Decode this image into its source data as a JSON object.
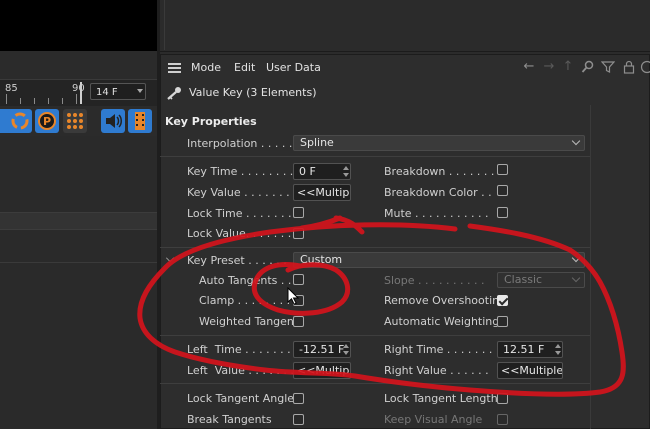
{
  "timeline": {
    "label_85": "85",
    "label_90": "90",
    "frame": "14 F"
  },
  "menubar": {
    "items": [
      "Mode",
      "Edit",
      "User Data"
    ]
  },
  "object_line": {
    "title": "Value Key (3 Elements)"
  },
  "section": {
    "title": "Key Properties"
  },
  "interpolation": {
    "label": "Interpolation . . . . .",
    "value": "Spline"
  },
  "key_time": {
    "label": "Key Time . . . . . . . .",
    "value": "0 F"
  },
  "key_value": {
    "label": "Key Value . . . . . . . .",
    "value": "<<Multiple Values>>"
  },
  "lock_time": {
    "label": "Lock Time . . . . . . . ."
  },
  "lock_value": {
    "label": "Lock Value. . . . . . . ."
  },
  "breakdown": {
    "label": "Breakdown . . . . . . ."
  },
  "breakdown_color": {
    "label": "Breakdown Color . ."
  },
  "mute": {
    "label": "Mute . . . . . . . . . . ."
  },
  "key_preset": {
    "label": "Key Preset . . . . . .",
    "value": "Custom"
  },
  "auto_tangents": {
    "label": "Auto Tangents . . ."
  },
  "slope": {
    "label": "Slope . . . . . . . . . .",
    "value": "Classic"
  },
  "clamp": {
    "label": "Clamp . . . . . . . . ."
  },
  "remove_overshooting": {
    "label": "Remove Overshooting",
    "checked": true
  },
  "weighted_tangent": {
    "label": "Weighted Tangent"
  },
  "automatic_weighting": {
    "label": "Automatic Weighting"
  },
  "left_time": {
    "label": "Left  Time . . . . . . .",
    "value": "-12.51 F"
  },
  "right_time": {
    "label": "Right Time . . . . . . .",
    "value": "12.51 F"
  },
  "left_value": {
    "label": "Left  Value . . . . . . .",
    "value": "<<Multiple Values>>"
  },
  "right_value": {
    "label": "Right Value . . . . . .",
    "value": "<<Multiple Values>>"
  },
  "lock_tangent_angles": {
    "label": "Lock Tangent Angles"
  },
  "lock_tangent_lengths": {
    "label": "Lock Tangent Lengths"
  },
  "break_tangents": {
    "label": "Break Tangents"
  },
  "keep_visual_angle": {
    "label": "Keep Visual Angle"
  },
  "colors": {
    "annotation_red": "#d4141c",
    "panel_bg": "#2d2d2d",
    "field_bg": "#1f1f1f"
  }
}
